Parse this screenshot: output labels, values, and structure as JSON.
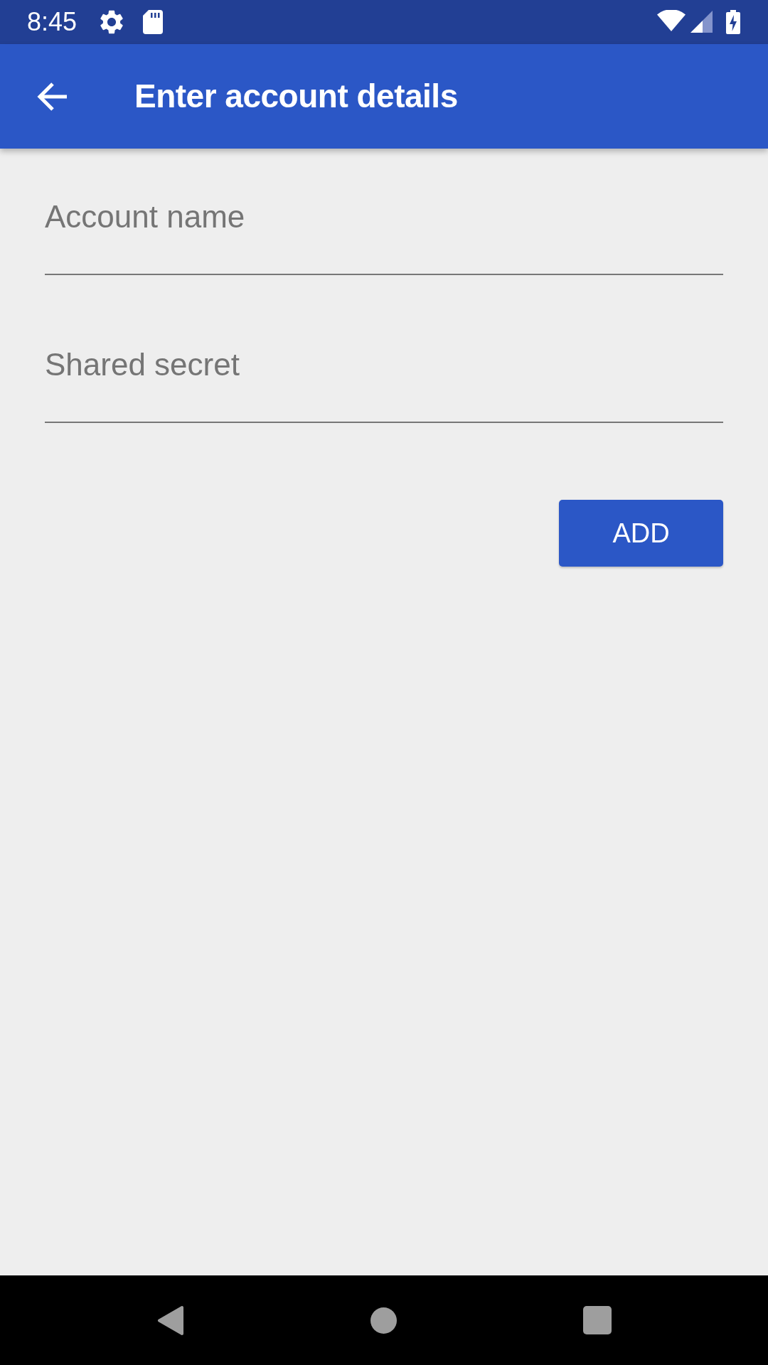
{
  "status_bar": {
    "time": "8:45"
  },
  "app_bar": {
    "title": "Enter account details"
  },
  "fields": [
    {
      "placeholder": "Account name"
    },
    {
      "placeholder": "Shared secret"
    }
  ],
  "button": {
    "label": "ADD"
  }
}
